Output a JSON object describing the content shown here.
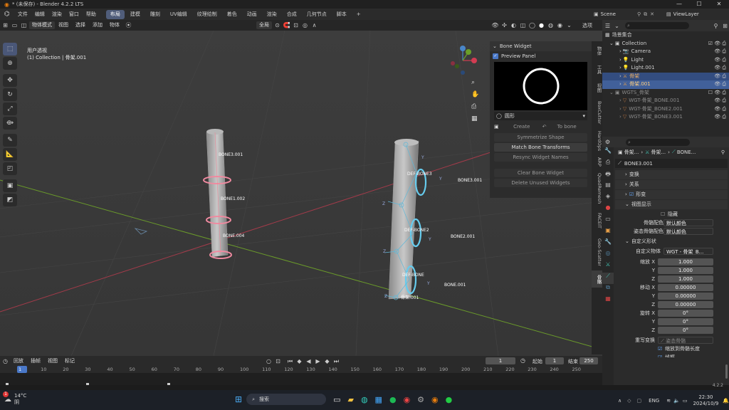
{
  "titlebar": {
    "title": "* (未保存) - Blender 4.2.2 LTS",
    "min": "—",
    "max": "☐",
    "close": "✕"
  },
  "menubar": {
    "items": [
      "文件",
      "编辑",
      "渲染",
      "窗口",
      "帮助"
    ],
    "workspaces": [
      "布局",
      "建模",
      "雕刻",
      "UV编辑",
      "纹理绘制",
      "着色",
      "动画",
      "渲染",
      "合成",
      "几何节点",
      "脚本",
      "+"
    ],
    "active_workspace": 0,
    "scene_label": "Scene",
    "viewlayer_label": "ViewLayer"
  },
  "vheader": {
    "mode": "物体模式",
    "menus": [
      "视图",
      "选择",
      "添加",
      "物体"
    ],
    "transform": "全局",
    "select_btn": "选项"
  },
  "viewport": {
    "view_name": "用户透视",
    "collection_info": "(1) Collection | 骨架.001",
    "labels_left": [
      "BONE3.001",
      "BONE1.002",
      "BONE.004"
    ],
    "labels_right": [
      "DEF-BONE3",
      "DEF-BONE2",
      "DEF-BONE",
      "BONE3.001",
      "BONE2.001",
      "BONE.001",
      "骨架.001"
    ],
    "axis_letters": [
      "Y",
      "Z",
      "Y",
      "Z",
      "Y",
      "Z",
      "Y"
    ]
  },
  "npanel": {
    "header": "Bone Widget",
    "preview_label": "Preview Panel",
    "shape_name": "圆形",
    "create": "Create",
    "to_bone": "To bone",
    "buttons": [
      "Symmetrize Shape",
      "Match Bone Transforms",
      "Resync Widget Names",
      "Clear Bone Widget",
      "Delete Unused Widgets"
    ],
    "tabs": [
      "物体",
      "工具",
      "视图",
      "BoxCutter",
      "HardOps",
      "ARP",
      "QuadRemesh",
      "FACEIT",
      "Geo-Scatter",
      "骨骼"
    ]
  },
  "outliner": {
    "items": [
      {
        "label": "场景集合",
        "indent": 0
      },
      {
        "label": "Collection",
        "indent": 1
      },
      {
        "label": "Camera",
        "indent": 2
      },
      {
        "label": "Light",
        "indent": 2
      },
      {
        "label": "Light.001",
        "indent": 2
      },
      {
        "label": "骨架",
        "indent": 2
      },
      {
        "label": "骨架.001",
        "indent": 2
      },
      {
        "label": "WGTS_骨架",
        "indent": 1
      },
      {
        "label": "WGT-骨架_BONE.001",
        "indent": 2
      },
      {
        "label": "WGT-骨架_BONE2.001",
        "indent": 2
      },
      {
        "label": "WGT-骨架_BONE3.001",
        "indent": 2
      }
    ]
  },
  "props": {
    "breadcrumb": [
      "骨架...",
      "骨架...",
      "BONE..."
    ],
    "bone_name": "BONE3.001",
    "sections": [
      "变换",
      "关系",
      "形变",
      "视图显示"
    ],
    "hide_label": "隐藏",
    "bone_color_label": "骨骼配色",
    "bone_color_val": "默认颜色",
    "pose_color_label": "姿态骨骼配色",
    "pose_color_val": "默认颜色",
    "custom_shape_label": "自定义形状",
    "custom_obj_label": "自定义物体",
    "custom_obj_val": "WGT - 骨架_B...",
    "scale_label": "缩放 X",
    "scale": [
      "1.000",
      "1.000",
      "1.000"
    ],
    "move_label": "移动 X",
    "move": [
      "0.00000",
      "0.00000",
      "0.00000"
    ],
    "rot_label": "旋转 X",
    "rot": [
      "0°",
      "0°",
      "0°"
    ],
    "override_label": "重写变换",
    "override_val": "姿态骨骼",
    "scale_bone_label": "缩放到骨骼长度",
    "wire_label": "线框",
    "version": "4.2.2"
  },
  "timeline": {
    "menus": [
      "回放",
      "插帧",
      "视图",
      "标记"
    ],
    "current_frame": "1",
    "start_label": "起始",
    "start": "1",
    "end_label": "结束",
    "end": "250",
    "ticks": [
      "1",
      "10",
      "20",
      "30",
      "40",
      "50",
      "60",
      "70",
      "80",
      "90",
      "100",
      "110",
      "120",
      "130",
      "140",
      "150",
      "160",
      "170",
      "180",
      "190",
      "200",
      "210",
      "220",
      "230",
      "240",
      "250"
    ]
  },
  "taskbar": {
    "weather_temp": "14°C",
    "weather_desc": "阴",
    "search": "搜索",
    "lang": "ENG",
    "time": "22:30",
    "date": "2024/10/9",
    "notif": "1"
  }
}
